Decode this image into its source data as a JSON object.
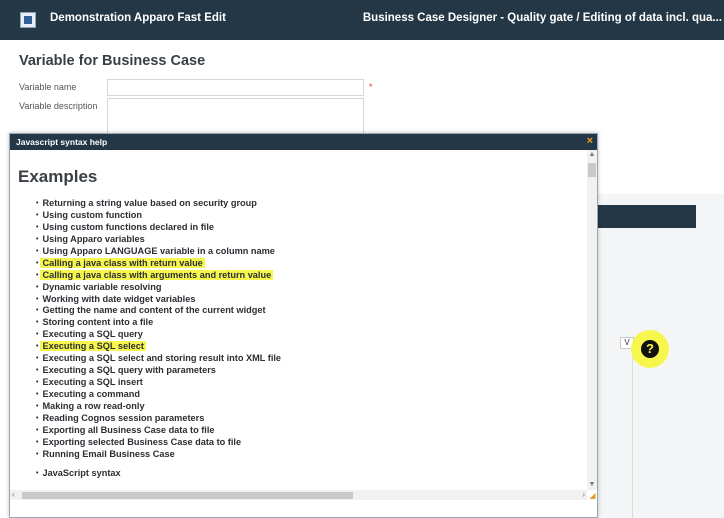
{
  "header": {
    "app_title": "Demonstration Apparo Fast Edit",
    "page_crumb": "Business Case Designer - Quality gate / Editing of data incl. qua..."
  },
  "form": {
    "title": "Variable for Business Case",
    "variable_name_label": "Variable name",
    "variable_description_label": "Variable description",
    "required_marker": "*"
  },
  "background": {
    "cell_text": "V",
    "help_icon_glyph": "?"
  },
  "dialog": {
    "title": "Javascript syntax help",
    "close_glyph": "×",
    "heading": "Examples",
    "examples": [
      {
        "label": "Returning a string value based on security group",
        "highlighted": false
      },
      {
        "label": "Using custom function",
        "highlighted": false
      },
      {
        "label": "Using custom functions declared in file",
        "highlighted": false
      },
      {
        "label": "Using Apparo variables",
        "highlighted": false
      },
      {
        "label": "Using Apparo LANGUAGE variable in a column name",
        "highlighted": false
      },
      {
        "label": "Calling a java class with return value",
        "highlighted": true
      },
      {
        "label": "Calling a java class with arguments and return value",
        "highlighted": true
      },
      {
        "label": "Dynamic variable resolving",
        "highlighted": false
      },
      {
        "label": "Working with date widget variables",
        "highlighted": false
      },
      {
        "label": "Getting the name and content of the current widget",
        "highlighted": false
      },
      {
        "label": "Storing content into a file",
        "highlighted": false
      },
      {
        "label": "Executing a SQL query",
        "highlighted": false
      },
      {
        "label": "Executing a SQL select",
        "highlighted": true
      },
      {
        "label": "Executing a SQL select and storing result into XML file",
        "highlighted": false
      },
      {
        "label": "Executing a SQL query with parameters",
        "highlighted": false
      },
      {
        "label": "Executing a SQL insert",
        "highlighted": false
      },
      {
        "label": "Executing a command",
        "highlighted": false
      },
      {
        "label": "Making a row read-only",
        "highlighted": false
      },
      {
        "label": "Reading Cognos session parameters",
        "highlighted": false
      },
      {
        "label": "Exporting all Business Case data to file",
        "highlighted": false
      },
      {
        "label": "Exporting selected Business Case data to file",
        "highlighted": false
      },
      {
        "label": "Running Email Business Case",
        "highlighted": false
      }
    ],
    "syntax_link": "JavaScript syntax"
  },
  "icons": {
    "app_logo": "app-logo-icon",
    "close": "close-icon",
    "help": "help-icon",
    "scroll_up": "chevron-up-icon",
    "scroll_down": "chevron-down-icon",
    "scroll_left": "chevron-left-icon",
    "scroll_right": "chevron-right-icon",
    "resize": "resize-grip-icon"
  },
  "colors": {
    "header_bg": "#233747",
    "highlight": "#f6f64c",
    "close_accent": "#f0a020"
  }
}
